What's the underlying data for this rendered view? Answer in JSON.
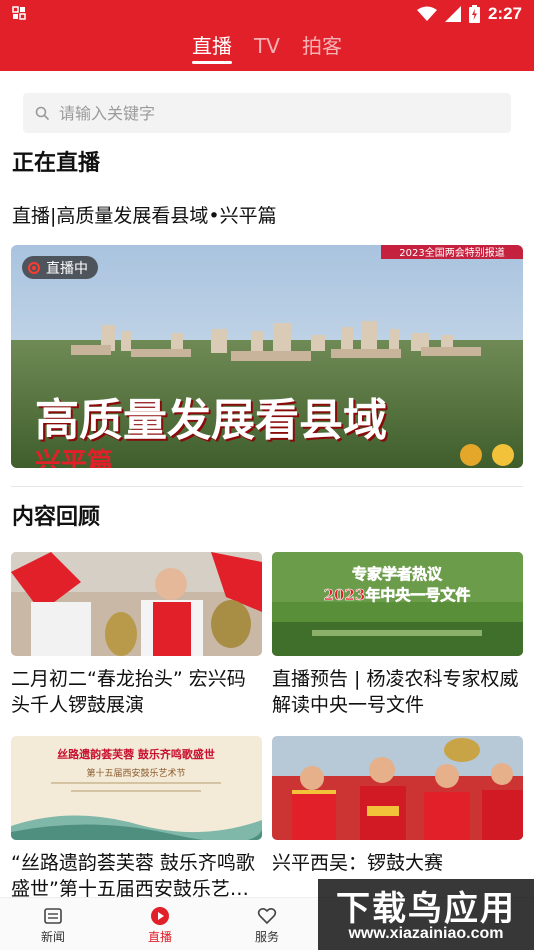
{
  "status_bar": {
    "time": "2:27",
    "icons": [
      "wifi-icon",
      "signal-icon",
      "battery-icon"
    ]
  },
  "tabs": [
    {
      "label": "直播",
      "active": true
    },
    {
      "label": "TV",
      "active": false
    },
    {
      "label": "拍客",
      "active": false
    }
  ],
  "search": {
    "placeholder": "请输入关键字"
  },
  "live_section": {
    "title": "正在直播",
    "item_title": "直播|高质量发展看县域•兴平篇",
    "badge": "直播中",
    "banner_corner": "2023全国两会特别报道",
    "banner_headline": "高质量发展看县域",
    "banner_subline": "兴平篇"
  },
  "review_section": {
    "title": "内容回顾",
    "items": [
      {
        "title": "二月初二“春龙抬头” 宏兴码头千人锣鼓展演"
      },
      {
        "title": "直播预告 | 杨凌农科专家权威解读中央一号文件",
        "thumb_line1": "专家学者热议",
        "thumb_line2": "2023年中央一号文件"
      },
      {
        "title": "“丝路遗韵荟芙蓉 鼓乐齐鸣歌盛世”第十五届西安鼓乐艺术节",
        "thumb_line1": "丝路遗韵荟芙蓉 鼓乐齐鸣歌盛世",
        "thumb_line2": "第十五届西安鼓乐艺术节"
      },
      {
        "title": "兴平西吴：锣鼓大赛"
      }
    ]
  },
  "bottom_nav": [
    {
      "label": "新闻",
      "icon": "news-icon",
      "active": false
    },
    {
      "label": "直播",
      "icon": "play-icon",
      "active": true
    },
    {
      "label": "服务",
      "icon": "service-icon",
      "active": false
    }
  ],
  "watermark": {
    "main": "下载鸟应用",
    "sub": "www.xiazainiao.com"
  },
  "colors": {
    "brand_red": "#e2202a",
    "live_dot": "#ff3b30"
  }
}
